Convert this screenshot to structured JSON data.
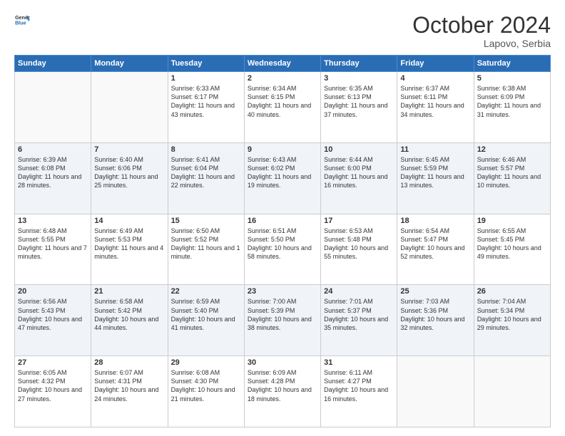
{
  "header": {
    "logo_general": "General",
    "logo_blue": "Blue",
    "month": "October 2024",
    "location": "Lapovo, Serbia"
  },
  "weekdays": [
    "Sunday",
    "Monday",
    "Tuesday",
    "Wednesday",
    "Thursday",
    "Friday",
    "Saturday"
  ],
  "weeks": [
    [
      {
        "day": "",
        "info": ""
      },
      {
        "day": "",
        "info": ""
      },
      {
        "day": "1",
        "info": "Sunrise: 6:33 AM\nSunset: 6:17 PM\nDaylight: 11 hours and 43 minutes."
      },
      {
        "day": "2",
        "info": "Sunrise: 6:34 AM\nSunset: 6:15 PM\nDaylight: 11 hours and 40 minutes."
      },
      {
        "day": "3",
        "info": "Sunrise: 6:35 AM\nSunset: 6:13 PM\nDaylight: 11 hours and 37 minutes."
      },
      {
        "day": "4",
        "info": "Sunrise: 6:37 AM\nSunset: 6:11 PM\nDaylight: 11 hours and 34 minutes."
      },
      {
        "day": "5",
        "info": "Sunrise: 6:38 AM\nSunset: 6:09 PM\nDaylight: 11 hours and 31 minutes."
      }
    ],
    [
      {
        "day": "6",
        "info": "Sunrise: 6:39 AM\nSunset: 6:08 PM\nDaylight: 11 hours and 28 minutes."
      },
      {
        "day": "7",
        "info": "Sunrise: 6:40 AM\nSunset: 6:06 PM\nDaylight: 11 hours and 25 minutes."
      },
      {
        "day": "8",
        "info": "Sunrise: 6:41 AM\nSunset: 6:04 PM\nDaylight: 11 hours and 22 minutes."
      },
      {
        "day": "9",
        "info": "Sunrise: 6:43 AM\nSunset: 6:02 PM\nDaylight: 11 hours and 19 minutes."
      },
      {
        "day": "10",
        "info": "Sunrise: 6:44 AM\nSunset: 6:00 PM\nDaylight: 11 hours and 16 minutes."
      },
      {
        "day": "11",
        "info": "Sunrise: 6:45 AM\nSunset: 5:59 PM\nDaylight: 11 hours and 13 minutes."
      },
      {
        "day": "12",
        "info": "Sunrise: 6:46 AM\nSunset: 5:57 PM\nDaylight: 11 hours and 10 minutes."
      }
    ],
    [
      {
        "day": "13",
        "info": "Sunrise: 6:48 AM\nSunset: 5:55 PM\nDaylight: 11 hours and 7 minutes."
      },
      {
        "day": "14",
        "info": "Sunrise: 6:49 AM\nSunset: 5:53 PM\nDaylight: 11 hours and 4 minutes."
      },
      {
        "day": "15",
        "info": "Sunrise: 6:50 AM\nSunset: 5:52 PM\nDaylight: 11 hours and 1 minute."
      },
      {
        "day": "16",
        "info": "Sunrise: 6:51 AM\nSunset: 5:50 PM\nDaylight: 10 hours and 58 minutes."
      },
      {
        "day": "17",
        "info": "Sunrise: 6:53 AM\nSunset: 5:48 PM\nDaylight: 10 hours and 55 minutes."
      },
      {
        "day": "18",
        "info": "Sunrise: 6:54 AM\nSunset: 5:47 PM\nDaylight: 10 hours and 52 minutes."
      },
      {
        "day": "19",
        "info": "Sunrise: 6:55 AM\nSunset: 5:45 PM\nDaylight: 10 hours and 49 minutes."
      }
    ],
    [
      {
        "day": "20",
        "info": "Sunrise: 6:56 AM\nSunset: 5:43 PM\nDaylight: 10 hours and 47 minutes."
      },
      {
        "day": "21",
        "info": "Sunrise: 6:58 AM\nSunset: 5:42 PM\nDaylight: 10 hours and 44 minutes."
      },
      {
        "day": "22",
        "info": "Sunrise: 6:59 AM\nSunset: 5:40 PM\nDaylight: 10 hours and 41 minutes."
      },
      {
        "day": "23",
        "info": "Sunrise: 7:00 AM\nSunset: 5:39 PM\nDaylight: 10 hours and 38 minutes."
      },
      {
        "day": "24",
        "info": "Sunrise: 7:01 AM\nSunset: 5:37 PM\nDaylight: 10 hours and 35 minutes."
      },
      {
        "day": "25",
        "info": "Sunrise: 7:03 AM\nSunset: 5:36 PM\nDaylight: 10 hours and 32 minutes."
      },
      {
        "day": "26",
        "info": "Sunrise: 7:04 AM\nSunset: 5:34 PM\nDaylight: 10 hours and 29 minutes."
      }
    ],
    [
      {
        "day": "27",
        "info": "Sunrise: 6:05 AM\nSunset: 4:32 PM\nDaylight: 10 hours and 27 minutes."
      },
      {
        "day": "28",
        "info": "Sunrise: 6:07 AM\nSunset: 4:31 PM\nDaylight: 10 hours and 24 minutes."
      },
      {
        "day": "29",
        "info": "Sunrise: 6:08 AM\nSunset: 4:30 PM\nDaylight: 10 hours and 21 minutes."
      },
      {
        "day": "30",
        "info": "Sunrise: 6:09 AM\nSunset: 4:28 PM\nDaylight: 10 hours and 18 minutes."
      },
      {
        "day": "31",
        "info": "Sunrise: 6:11 AM\nSunset: 4:27 PM\nDaylight: 10 hours and 16 minutes."
      },
      {
        "day": "",
        "info": ""
      },
      {
        "day": "",
        "info": ""
      }
    ]
  ]
}
